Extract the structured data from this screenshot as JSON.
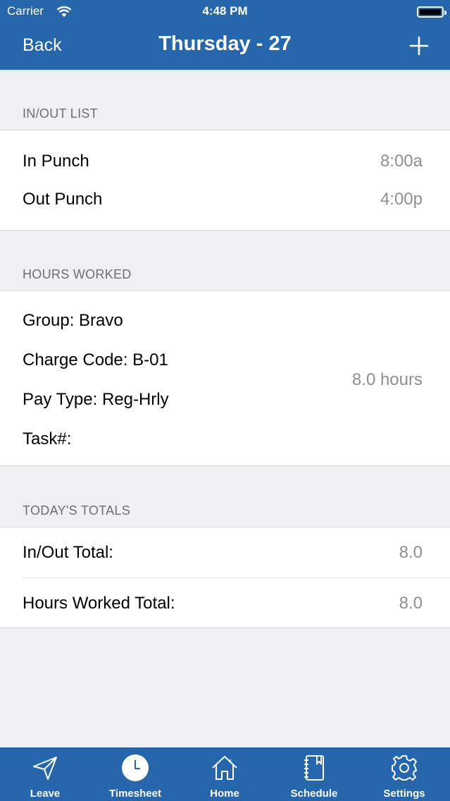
{
  "status_bar": {
    "carrier": "Carrier",
    "time": "4:48 PM"
  },
  "nav": {
    "back_label": "Back",
    "title": "Thursday - 27"
  },
  "inout": {
    "header": "IN/OUT LIST",
    "rows": [
      {
        "label": "In Punch",
        "value": "8:00a"
      },
      {
        "label": "Out Punch",
        "value": "4:00p"
      }
    ]
  },
  "hours_worked": {
    "header": "HOURS WORKED",
    "group": "Group: Bravo",
    "charge_code": "Charge Code: B-01",
    "pay_type": "Pay Type: Reg-Hrly",
    "task": "Task#:",
    "hours": "8.0 hours"
  },
  "totals": {
    "header": "TODAY'S TOTALS",
    "rows": [
      {
        "label": "In/Out Total:",
        "value": "8.0"
      },
      {
        "label": "Hours Worked Total:",
        "value": "8.0"
      }
    ]
  },
  "tabs": [
    {
      "label": "Leave",
      "icon": "paper-plane-icon"
    },
    {
      "label": "Timesheet",
      "icon": "clock-icon",
      "selected": true
    },
    {
      "label": "Home",
      "icon": "home-icon"
    },
    {
      "label": "Schedule",
      "icon": "notebook-icon"
    },
    {
      "label": "Settings",
      "icon": "gear-icon"
    }
  ],
  "colors": {
    "bar": "#2566ac",
    "background": "#efeff4",
    "value_gray": "#8e8e93"
  }
}
